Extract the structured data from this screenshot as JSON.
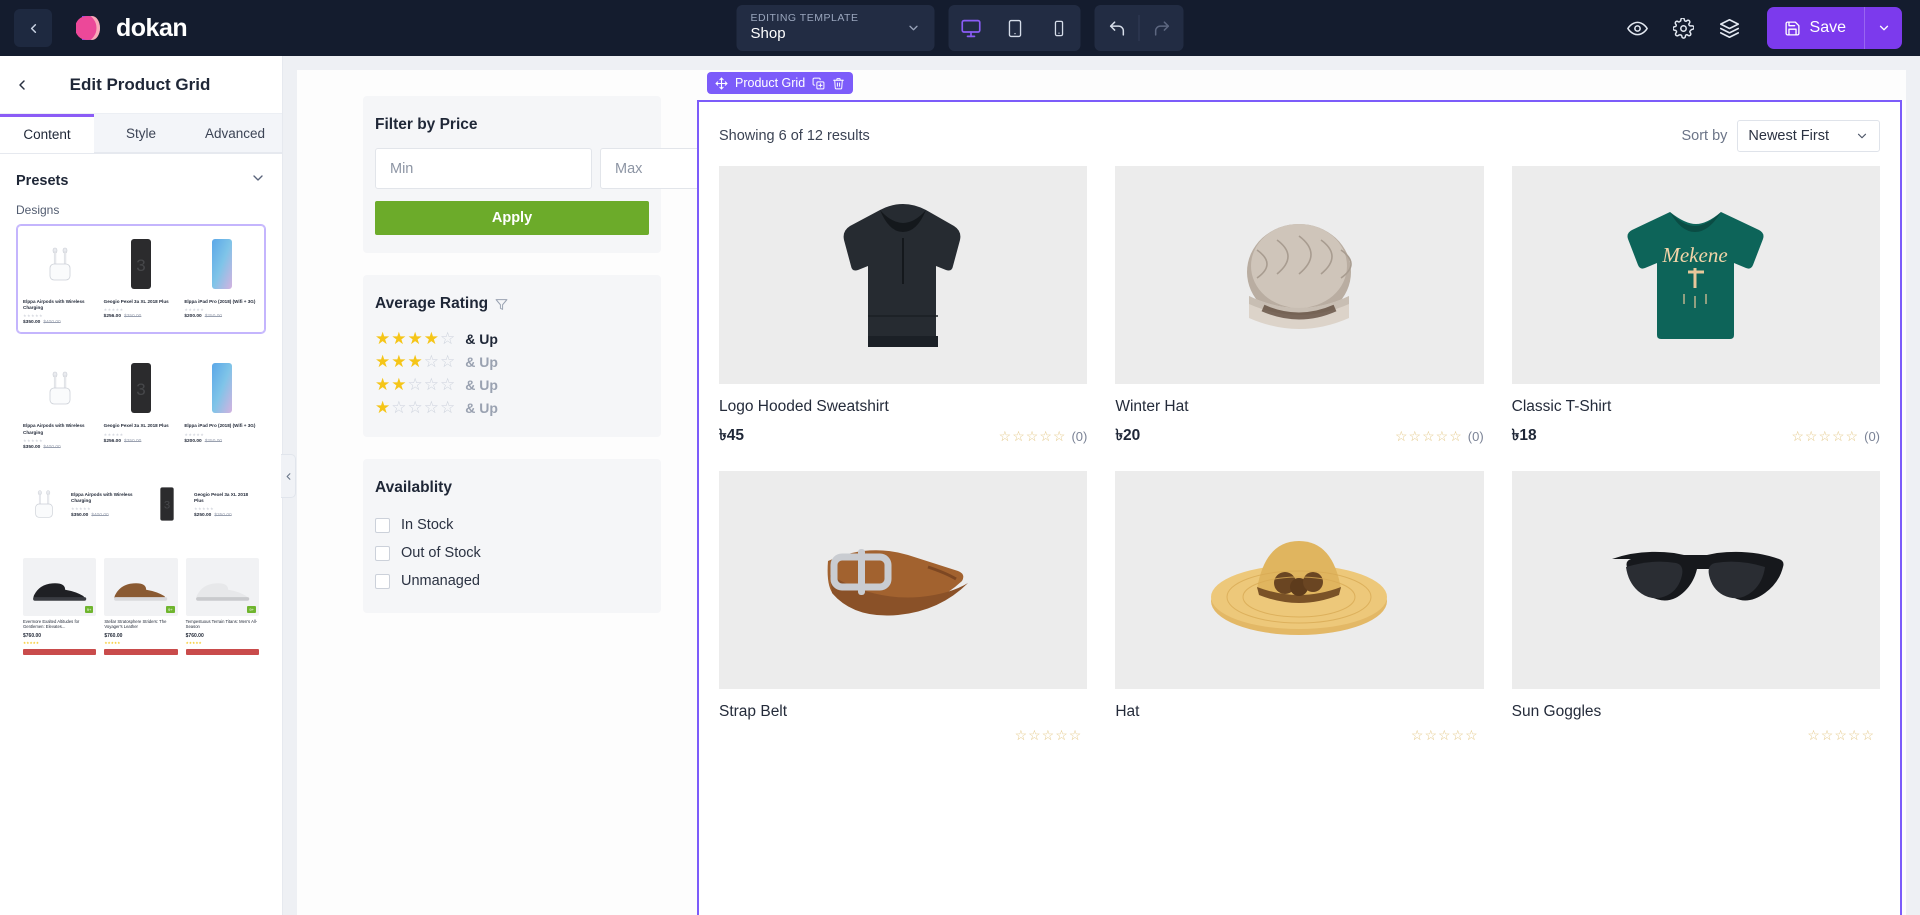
{
  "topbar": {
    "back_icon": "chevron-left-icon",
    "brand": "dokan",
    "template": {
      "label": "EDITING TEMPLATE",
      "value": "Shop",
      "caret": "chevron-down-icon"
    },
    "devices": [
      {
        "name": "desktop-view",
        "icon": "desktop-icon",
        "active": true
      },
      {
        "name": "tablet-view",
        "icon": "tablet-icon",
        "active": false
      },
      {
        "name": "mobile-view",
        "icon": "mobile-icon",
        "active": false
      }
    ],
    "history": [
      {
        "name": "undo-button",
        "icon": "undo-icon",
        "enabled": true
      },
      {
        "name": "redo-button",
        "icon": "redo-icon",
        "enabled": false
      }
    ],
    "right_icons": [
      {
        "name": "preview-button",
        "icon": "eye-icon"
      },
      {
        "name": "settings-button",
        "icon": "gear-icon"
      },
      {
        "name": "layers-button",
        "icon": "layers-icon"
      }
    ],
    "save_label": "Save",
    "save_icon": "floppy-disk-icon",
    "save_caret": "chevron-down-icon",
    "accent_color": "#7c3aed",
    "bg_color": "#141c2e"
  },
  "panel": {
    "back_icon": "chevron-left-icon",
    "title": "Edit Product Grid",
    "tabs": [
      {
        "label": "Content",
        "active": true
      },
      {
        "label": "Style",
        "active": false
      },
      {
        "label": "Advanced",
        "active": false
      }
    ],
    "presets_title": "Presets",
    "presets_caret": "chevron-down-icon",
    "designs_label": "Designs",
    "designs": [
      {
        "selected": true,
        "items": [
          {
            "name": "Elppa Airpods with Wireless Charging",
            "price": "$350.00",
            "old_price": "$400.00"
          },
          {
            "name": "Geogio Pexel 3a XL 2018 Plus",
            "price": "$256.00",
            "old_price": "$350.00"
          },
          {
            "name": "Elppa iPad Pro (2018) (Wifi + 3G)",
            "price": "$200.00",
            "old_price": "$250.00"
          }
        ]
      },
      {
        "selected": false,
        "items": [
          {
            "name": "Elppa Airpods with Wireless Charging",
            "price": "$350.00",
            "old_price": "$400.00"
          },
          {
            "name": "Geogio Pexel 3a XL 2018 Plus",
            "price": "$256.00",
            "old_price": "$350.00"
          },
          {
            "name": "Elppa iPad Pro (2018) (Wifi + 3G)",
            "price": "$200.00",
            "old_price": "$250.00"
          }
        ]
      },
      {
        "selected": false,
        "items": [
          {
            "name": "Elppa Airpods with Wireless Charging",
            "price": "$350.00",
            "old_price": "$400.00"
          },
          {
            "name": "Geogio Pexel 3a XL 2018 Plus",
            "price": "$250.00",
            "old_price": "$350.00"
          }
        ]
      },
      {
        "selected": false,
        "items": [
          {
            "name": "Evermore Exalted Altitudes for Gentlemen: Elevates...",
            "price": "$760.00",
            "badge": "9+"
          },
          {
            "name": "Stellar Stratosphere Striders: The Voyager's Leather",
            "price": "$760.00",
            "badge": "9+"
          },
          {
            "name": "Tempestuous Terrain Titans: Men's All-Season",
            "price": "$760.00",
            "badge": "9+"
          }
        ]
      }
    ],
    "collapse_icon": "chevron-left-icon"
  },
  "filters": {
    "price": {
      "title": "Filter by Price",
      "min_placeholder": "Min",
      "max_placeholder": "Max",
      "min_value": "",
      "max_value": "",
      "apply_label": "Apply",
      "apply_color": "#6cab2a"
    },
    "rating": {
      "title": "Average Rating",
      "filter_icon": "funnel-icon",
      "star_color": "#f5c518",
      "rows": [
        {
          "filled": 4,
          "label": "& Up",
          "highlight": true
        },
        {
          "filled": 3,
          "label": "& Up",
          "highlight": false
        },
        {
          "filled": 2,
          "label": "& Up",
          "highlight": false
        },
        {
          "filled": 1,
          "label": "& Up",
          "highlight": false
        }
      ]
    },
    "availability": {
      "title": "Availablity",
      "options": [
        {
          "label": "In Stock",
          "checked": false
        },
        {
          "label": "Out of Stock",
          "checked": false
        },
        {
          "label": "Unmanaged",
          "checked": false
        }
      ]
    }
  },
  "grid": {
    "badge_label": "Product Grid",
    "badge_icons": [
      "move-icon",
      "duplicate-icon",
      "trash-icon"
    ],
    "badge_color": "#7c5cfa",
    "showing": "Showing 6 of 12 results",
    "sort_by_label": "Sort by",
    "sort_value": "Newest First",
    "sort_caret": "chevron-down-icon",
    "products": [
      {
        "name": "Logo Hooded Sweatshirt",
        "price": "৳45",
        "rating": 0,
        "reviews": "(0)",
        "image": "black-hoodie"
      },
      {
        "name": "Winter Hat",
        "price": "৳20",
        "rating": 0,
        "reviews": "(0)",
        "image": "knit-beanie"
      },
      {
        "name": "Classic T-Shirt",
        "price": "৳18",
        "rating": 0,
        "reviews": "(0)",
        "image": "teal-tshirt"
      },
      {
        "name": "Strap Belt",
        "price": "",
        "rating": 0,
        "reviews": "",
        "image": "leather-belt"
      },
      {
        "name": "Hat",
        "price": "",
        "rating": 0,
        "reviews": "",
        "image": "straw-hat"
      },
      {
        "name": "Sun Goggles",
        "price": "",
        "rating": 0,
        "reviews": "",
        "image": "sunglasses"
      }
    ]
  }
}
